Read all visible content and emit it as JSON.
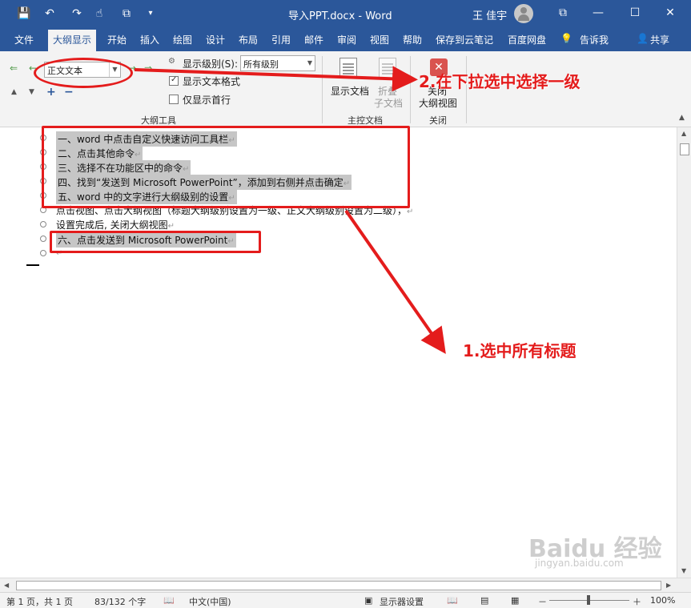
{
  "window": {
    "title": "导入PPT.docx  -  Word",
    "user": "王 佳宇",
    "buttons": {
      "minimize": "—",
      "restore": "☐",
      "close": "✕",
      "ribbon_display": "⧉"
    }
  },
  "quick_access": [
    "save-icon",
    "undo-icon",
    "redo-icon",
    "touch-mode-icon",
    "customize-icon"
  ],
  "tabs": [
    {
      "label": "文件"
    },
    {
      "label": "大纲显示",
      "active": true
    },
    {
      "label": "开始"
    },
    {
      "label": "插入"
    },
    {
      "label": "绘图"
    },
    {
      "label": "设计"
    },
    {
      "label": "布局"
    },
    {
      "label": "引用"
    },
    {
      "label": "邮件"
    },
    {
      "label": "审阅"
    },
    {
      "label": "视图"
    },
    {
      "label": "帮助"
    },
    {
      "label": "保存到云笔记"
    },
    {
      "label": "百度网盘"
    },
    {
      "label": "告诉我"
    },
    {
      "label": "共享"
    }
  ],
  "ribbon": {
    "outline_level": "正文文本",
    "show_level_label": "显示级别(S):",
    "show_level_value": "所有级别",
    "show_text_format": "显示文本格式",
    "show_first_line_only": "仅显示首行",
    "outline_tools_group": "大纲工具",
    "show_document": "显示文档",
    "collapse_subdocs_1": "折叠",
    "collapse_subdocs_2": "子文档",
    "master_doc_group": "主控文档",
    "close_outline_1": "关闭",
    "close_outline_2": "大纲视图",
    "close_group": "关闭"
  },
  "document": {
    "rows": [
      {
        "text": "一、word 中点击自定义快速访问工具栏",
        "selected": true
      },
      {
        "text": "二、点击其他命令",
        "selected": true
      },
      {
        "text": "三、选择不在功能区中的命令",
        "selected": true
      },
      {
        "text": "四、找到“发送到 Microsoft PowerPoint”，添加到右侧并点击确定",
        "selected": true
      },
      {
        "text": "五、word 中的文字进行大纲级别的设置",
        "selected": true
      },
      {
        "text": "点击视图、点击大纲视图（标题大纲级别设置为一级、正文大纲级别设置为二级），",
        "selected": false
      },
      {
        "text": "设置完成后, 关闭大纲视图",
        "selected": false
      },
      {
        "text": "六、点击发送到 Microsoft PowerPoint",
        "selected": true
      },
      {
        "text": "",
        "selected": false
      }
    ],
    "pilcrow": "↵"
  },
  "annotations": {
    "step2": "2.在下拉选中选择一级",
    "step1": "1.选中所有标题"
  },
  "status": {
    "page": "第 1 页，共 1 页",
    "words": "83/132 个字",
    "language": "中文(中国)",
    "display_settings": "显示器设置",
    "zoom_minus": "－",
    "zoom_plus": "＋",
    "zoom": "100%"
  },
  "watermark": {
    "main": "Baidu 经验",
    "sub": "jingyan.baidu.com"
  },
  "colors": {
    "accent": "#2b579a",
    "annotation": "#e41c1c",
    "selection": "#c6c6c6"
  }
}
